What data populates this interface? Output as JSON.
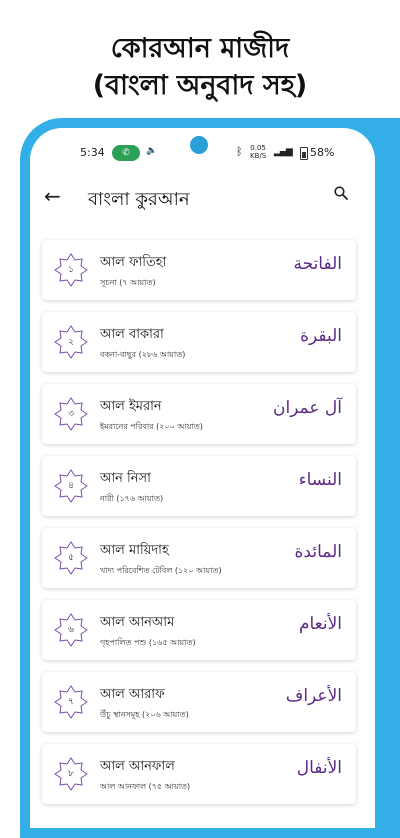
{
  "headline": {
    "line1": "কোরআন মাজীদ",
    "line2": "(বাংলা অনুবাদ সহ)"
  },
  "status_bar": {
    "time": "5:34",
    "net_speed_value": "0.05",
    "net_speed_unit": "KB/S",
    "battery": "58%"
  },
  "app_bar": {
    "title": "বাংলা কুরআন",
    "back_icon": "arrow-left",
    "search_icon": "magnifier"
  },
  "colors": {
    "accent_blue": "#34aee7",
    "arabic_text": "#5b2a86",
    "star_outline": "#7a4fa0"
  },
  "surahs": [
    {
      "number": "১",
      "name": "আল ফাতিহা",
      "subtitle": "সূচনা (৭ আয়াত)",
      "arabic": "الفاتحة"
    },
    {
      "number": "২",
      "name": "আল বাকারা",
      "subtitle": "বকনা-বাছুর (২৮৬ আয়াত)",
      "arabic": "البقرة"
    },
    {
      "number": "৩",
      "name": "আল ইমরান",
      "subtitle": "ইমরানের পরিবার (২০০ আয়াত)",
      "arabic": "آل عمران"
    },
    {
      "number": "৪",
      "name": "আন নিসা",
      "subtitle": "নারী (১৭৬ আয়াত)",
      "arabic": "النساء"
    },
    {
      "number": "৫",
      "name": "আল মায়িদাহ",
      "subtitle": "খাদ্য পরিবেশিত টেবিল (১২০ আয়াত)",
      "arabic": "المائدة"
    },
    {
      "number": "৬",
      "name": "আল আনআম",
      "subtitle": "গৃহপালিত পশু (১৬৫ আয়াত)",
      "arabic": "الأنعام"
    },
    {
      "number": "৭",
      "name": "আল আরাফ",
      "subtitle": "উঁচু স্থানসমূহ (২০৬ আয়াত)",
      "arabic": "الأعراف"
    },
    {
      "number": "৮",
      "name": "আল আনফাল",
      "subtitle": "আল আনফাল (৭৫ আয়াত)",
      "arabic": "الأنفال"
    }
  ]
}
